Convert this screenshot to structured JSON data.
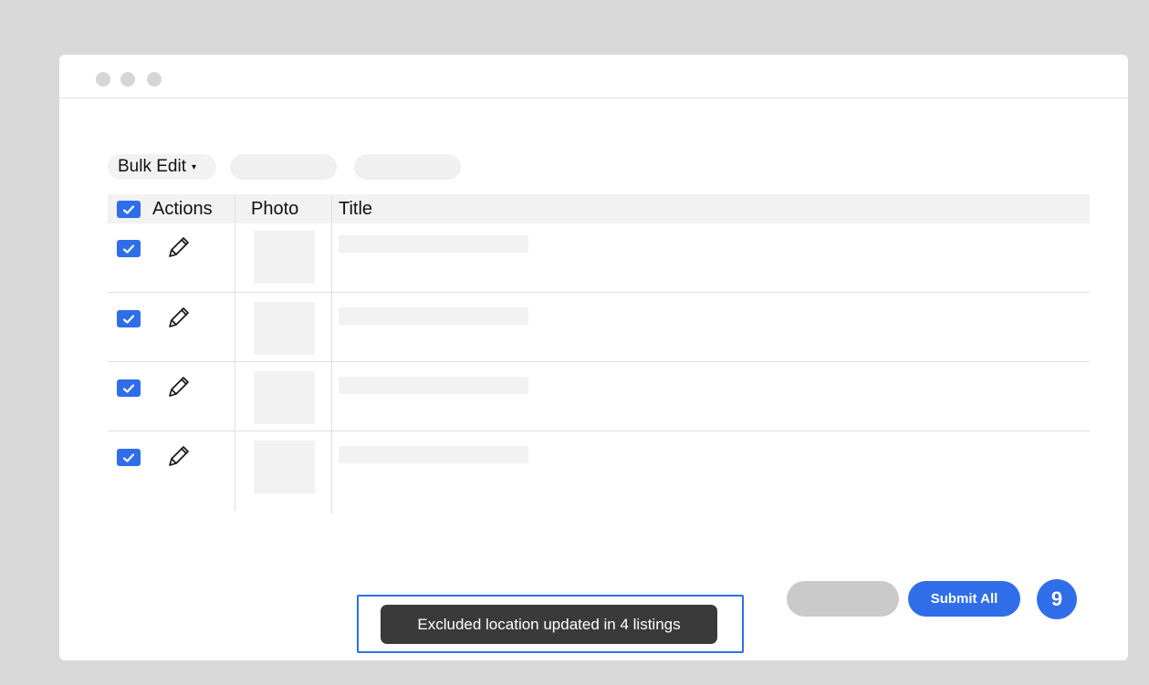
{
  "toolbar": {
    "bulk_edit_label": "Bulk Edit",
    "bulk_edit_caret": "▾"
  },
  "table": {
    "columns": [
      "Actions",
      "Photo",
      "Title"
    ],
    "header_checked": true,
    "rows": [
      {
        "checked": true
      },
      {
        "checked": true
      },
      {
        "checked": true
      },
      {
        "checked": true
      }
    ]
  },
  "footer": {
    "submit_label": "Submit All",
    "step_number": "9"
  },
  "toast": {
    "message": "Excluded location updated in 4 listings"
  },
  "colors": {
    "accent": "#2f6ee8",
    "toast_bg": "#3a3a3a",
    "placeholder": "#f2f2f2",
    "background": "#d9d9d9"
  },
  "icons": {
    "checkbox": "checkmark-icon",
    "edit": "pencil-icon",
    "window_controls": "traffic-light-dots"
  }
}
